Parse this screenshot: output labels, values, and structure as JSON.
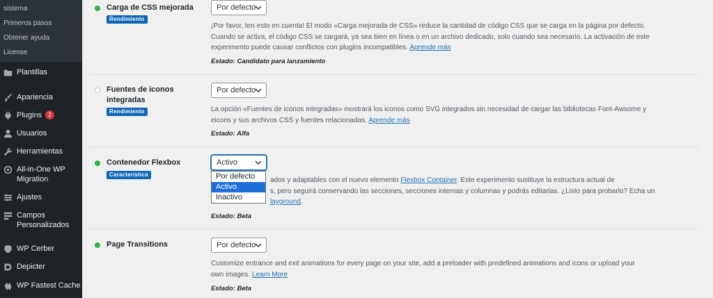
{
  "sidebar": {
    "submenu": [
      "sistema",
      "Primeros pasos",
      "Obtener ayuda",
      "License"
    ],
    "menu": [
      {
        "label": "Plantillas",
        "icon": "folder-icon"
      },
      {
        "label": "Apariencia",
        "icon": "brush-icon"
      },
      {
        "label": "Plugins",
        "icon": "plug-icon",
        "badge": "2"
      },
      {
        "label": "Usuarios",
        "icon": "user-icon"
      },
      {
        "label": "Herramientas",
        "icon": "wrench-icon"
      },
      {
        "label": "All-in-One WP Migration",
        "icon": "migration-icon"
      },
      {
        "label": "Ajustes",
        "icon": "settings-icon"
      },
      {
        "label": "Campos Personalizados",
        "icon": "fields-icon"
      },
      {
        "label": "WP Cerber",
        "icon": "shield-icon"
      },
      {
        "label": "Depicter",
        "icon": "depicter-icon"
      },
      {
        "label": "WP Fastest Cache",
        "icon": "cache-icon"
      }
    ]
  },
  "experiments": [
    {
      "title": "Carga de CSS mejorada",
      "tag": "Rendimiento",
      "active": true,
      "select": "Por defecto",
      "desc": "¡Por favor, ten esto en cuenta! El modo «Carga mejorada de CSS» reduce la cantidad de código CSS que se carga en la página por defecto. Cuando se activa, el código CSS se cargará, ya sea bien en línea o en un archivo dedicado, solo cuando sea necesario. La activación de este experimento puede causar conflictos con plugins incompatibles.",
      "link": "Aprende más",
      "status": "Estado: Candidato para lanzamiento"
    },
    {
      "title": "Fuentes de iconos integradas",
      "tag": "Rendimiento",
      "active": false,
      "select": "Por defecto",
      "desc": "La opción «Fuentes de iconos integradas» mostrará los iconos como SVG integrados sin necesidad de cargar las bibliotecas Font-Awsome y eicons y sus archivos CSS y fuentes relacionadas.",
      "link": "Aprende más",
      "status": "Estado: Alfa"
    },
    {
      "title": "Contenedor Flexbox",
      "tag": "Característica",
      "active": true,
      "select": "Activo",
      "desc_line1_a": "ados y adaptables con el nuevo elemento",
      "desc_line1_link": "Flexbox Container",
      "desc_line1_b": ". Este experimento sustituye la estructura actual de",
      "desc_line2": "s, pero seguirá conservando las secciones, secciones internas y columnas y podrás editarlas. ¿Listo para probarlo? Echa un",
      "desc_line3_link": "layground",
      "desc_line3_b": ".",
      "status": "Estado: Beta"
    },
    {
      "title": "Page Transitions",
      "active": true,
      "select": "Por defecto",
      "desc": "Customize entrance and exit animations for every page on your site, add a preloader with predefined animations and icons or upload your own images.",
      "link": "Learn More",
      "status": "Estado: Beta"
    }
  ],
  "dropdown": {
    "options": [
      "Por defecto",
      "Activo",
      "Inactivo"
    ],
    "selected": "Activo"
  }
}
